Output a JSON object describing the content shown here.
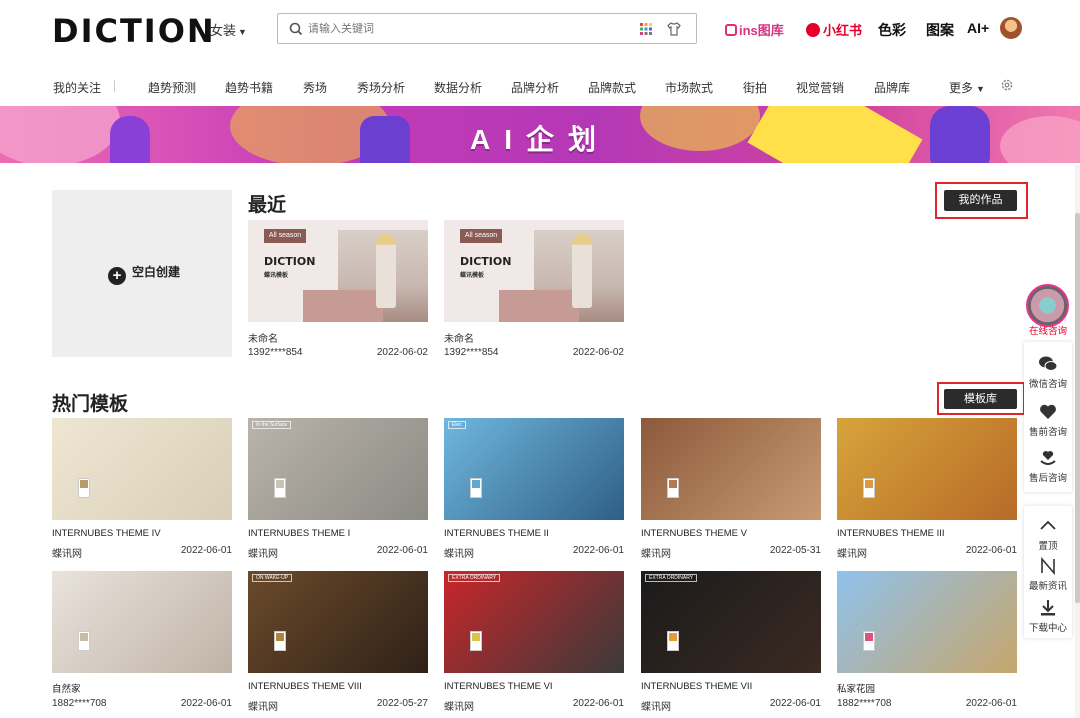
{
  "header": {
    "logo": "DICTION",
    "category": "女装",
    "search_placeholder": "请输入关键词",
    "ins_label": "ins图库",
    "xhs_label": "小红书",
    "links": [
      "色彩",
      "图案",
      "AI+"
    ]
  },
  "nav": {
    "items": [
      "我的关注",
      "趋势预测",
      "趋势书籍",
      "秀场",
      "秀场分析",
      "数据分析",
      "品牌分析",
      "品牌款式",
      "市场款式",
      "街拍",
      "视觉营销",
      "品牌库"
    ],
    "more": "更多"
  },
  "banner": {
    "title": "AI企划"
  },
  "recent": {
    "title": "最近",
    "my_works_label": "我的作品",
    "blank_create_label": "空白创建",
    "cards": [
      {
        "tag": "All season",
        "logo": "DICTION",
        "subtitle": "蝶讯模板",
        "name": "未命名",
        "user": "1392****854",
        "date": "2022-06-02"
      },
      {
        "tag": "All season",
        "logo": "DICTION",
        "subtitle": "蝶讯模板",
        "name": "未命名",
        "user": "1392****854",
        "date": "2022-06-02"
      }
    ]
  },
  "hot": {
    "title": "热门模板",
    "library_label": "模板库",
    "templates": [
      {
        "title": "INTERNUBES THEME IV",
        "source": "蝶讯网",
        "date": "2022-06-01",
        "label": "",
        "colors": [
          "#efe6d2",
          "#d8cfb8"
        ],
        "swatch": "#b89b6a"
      },
      {
        "title": "INTERNUBES THEME I",
        "source": "蝶讯网",
        "date": "2022-06-01",
        "label": "In the Surface",
        "colors": [
          "#b9b4ab",
          "#8c8a84"
        ],
        "swatch": "#c8c3b8"
      },
      {
        "title": "INTERNUBES THEME II",
        "source": "蝶讯网",
        "date": "2022-06-01",
        "label": "Elec",
        "colors": [
          "#6fb7de",
          "#2f5f86"
        ],
        "swatch": "#5fa8d3"
      },
      {
        "title": "INTERNUBES THEME V",
        "source": "蝶讯网",
        "date": "2022-05-31",
        "label": "",
        "colors": [
          "#8c5a3a",
          "#c79a74"
        ],
        "swatch": "#b77a4f"
      },
      {
        "title": "INTERNUBES THEME III",
        "source": "蝶讯网",
        "date": "2022-06-01",
        "label": "",
        "colors": [
          "#d7a43a",
          "#b76a28"
        ],
        "swatch": "#d99a40"
      },
      {
        "title": "自然家",
        "source": "1882****708",
        "date": "2022-06-01",
        "label": "",
        "colors": [
          "#e9e3dc",
          "#bfb3a6"
        ],
        "swatch": "#c9b9a6"
      },
      {
        "title": "INTERNUBES THEME VIII",
        "source": "蝶讯网",
        "date": "2022-05-27",
        "label": "ON WAKE-UP",
        "colors": [
          "#6b4a2a",
          "#2f2118"
        ],
        "swatch": "#b0843f"
      },
      {
        "title": "INTERNUBES THEME VI",
        "source": "蝶讯网",
        "date": "2022-06-01",
        "label": "EXTRA ORDINARY",
        "colors": [
          "#c8262a",
          "#3a3a3a"
        ],
        "swatch": "#d9c54a"
      },
      {
        "title": "INTERNUBES THEME VII",
        "source": "蝶讯网",
        "date": "2022-06-01",
        "label": "EXTRA ORDINARY",
        "colors": [
          "#1b1b1b",
          "#3a2a22"
        ],
        "swatch": "#e59a3d"
      },
      {
        "title": "私家花园",
        "source": "1882****708",
        "date": "2022-06-01",
        "label": "",
        "colors": [
          "#8fc2ec",
          "#c7a56b"
        ],
        "swatch": "#d9537a"
      }
    ]
  },
  "float_bar": {
    "online": "在线咨询",
    "wechat": "微信咨询",
    "presale": "售前咨询",
    "aftersale": "售后咨询",
    "top": "置顶",
    "news": "最新资讯",
    "download": "下载中心"
  },
  "colors": {
    "accent_red": "#e0252c",
    "dark_button": "#2b2b2b",
    "banner_pink": "#c33bb8"
  }
}
